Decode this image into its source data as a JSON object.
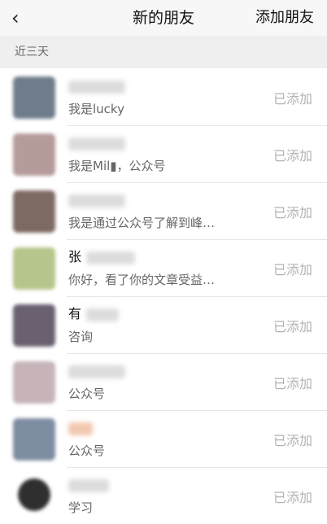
{
  "nav": {
    "back_icon": "chevron-left-icon",
    "title": "新的朋友",
    "add_friend_label": "添加朋友"
  },
  "section": {
    "label": "近三天"
  },
  "colors": {
    "avatars": [
      "#6f7c8b",
      "#b59b9a",
      "#7d6a63",
      "#b6c58b",
      "#6a6070",
      "#c6b4b8",
      "#7f8da2",
      "#2f2f2f"
    ]
  },
  "friends": [
    {
      "name": "",
      "message": "我是lucky",
      "status": "已添加"
    },
    {
      "name": "",
      "message": "我是Mil▮，公众号",
      "status": "已添加"
    },
    {
      "name": "",
      "message": "我是通过公众号了解到峰…",
      "status": "已添加"
    },
    {
      "name": "张",
      "message": "你好，看了你的文章受益…",
      "status": "已添加"
    },
    {
      "name": "有",
      "message": "咨询",
      "status": "已添加"
    },
    {
      "name": "",
      "message": "公众号",
      "status": "已添加"
    },
    {
      "name": "",
      "message": "公众号",
      "status": "已添加"
    },
    {
      "name": "",
      "message": "学习",
      "status": "已添加"
    }
  ]
}
